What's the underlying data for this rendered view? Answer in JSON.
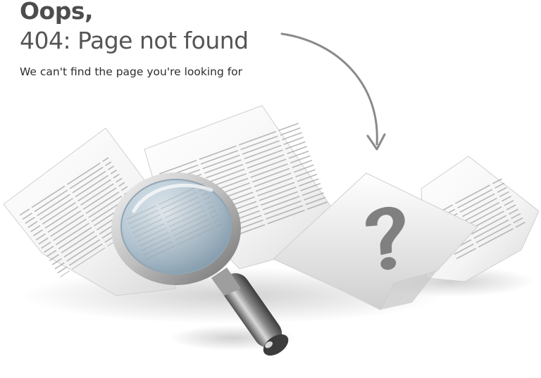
{
  "headline": "Oops,",
  "subhead": "404: Page not found",
  "message": "We can't find the page you're looking for",
  "colors": {
    "heading": "#4d4d4d",
    "arrow": "#8a8a8a",
    "question_mark": "#808080",
    "lens": "#a9c3d6",
    "paper": "#f7f7f7"
  },
  "icons": {
    "arrow": "curved-arrow-icon",
    "magnifier": "magnifying-glass-icon",
    "question": "question-mark-icon"
  }
}
